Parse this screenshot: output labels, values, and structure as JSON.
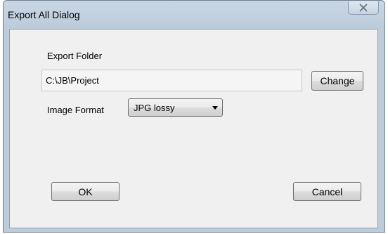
{
  "window": {
    "title": "Export All Dialog",
    "close_glyph": "✕"
  },
  "export_folder": {
    "label": "Export Folder",
    "value": "C:\\JB\\Project",
    "change_label": "Change"
  },
  "image_format": {
    "label": "Image Format",
    "selected": "JPG lossy"
  },
  "buttons": {
    "ok": "OK",
    "cancel": "Cancel"
  },
  "icons": {
    "close": "close-icon",
    "dropdown": "chevron-down-icon"
  },
  "colors": {
    "window_frame": "#bfcddb",
    "client_bg": "#f0f0f0"
  }
}
